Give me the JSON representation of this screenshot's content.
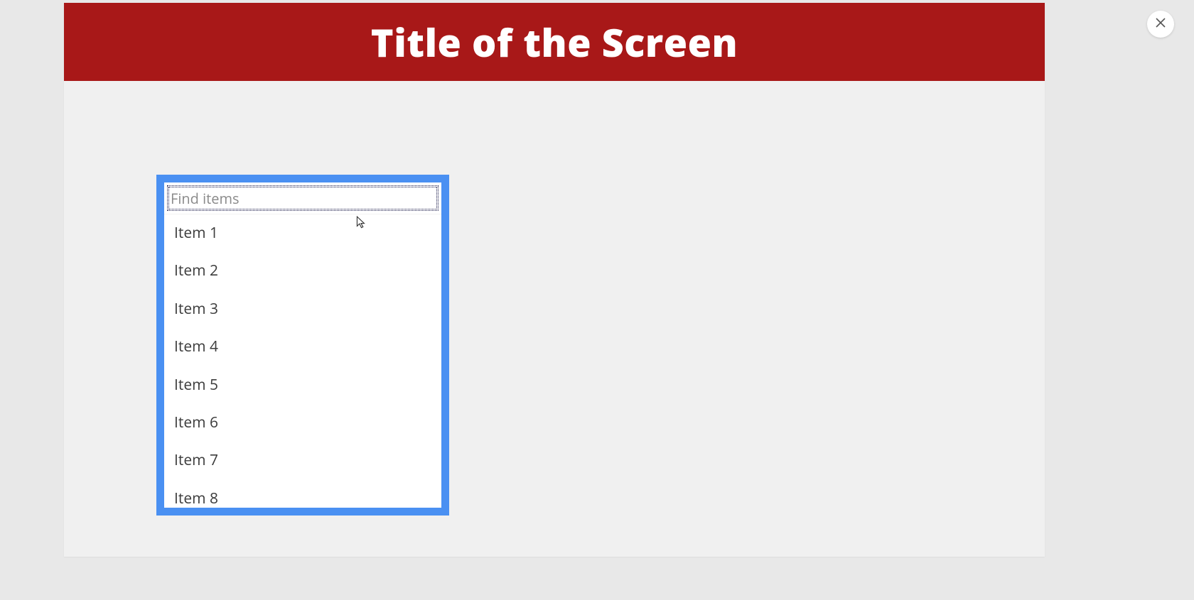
{
  "header": {
    "title": "Title of the Screen"
  },
  "close": {
    "label": "Close"
  },
  "dropdown": {
    "search_placeholder": "Find items",
    "items": [
      "Item 1",
      "Item 2",
      "Item 3",
      "Item 4",
      "Item 5",
      "Item 6",
      "Item 7",
      "Item 8"
    ]
  }
}
